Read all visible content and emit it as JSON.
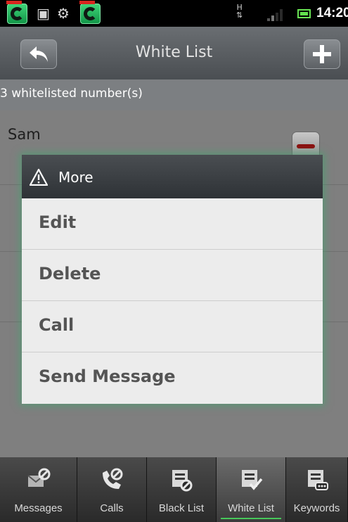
{
  "status_bar": {
    "network_type": "H",
    "time": "14:20",
    "colors": {
      "app_icon": "#1fb35a",
      "battery": "#62e04d"
    }
  },
  "title_bar": {
    "title": "White List",
    "back_icon": "back-arrow-icon",
    "add_icon": "plus-icon"
  },
  "count_text": "3 whitelisted number(s)",
  "list": {
    "contacts": [
      {
        "name": "Sam"
      }
    ]
  },
  "dialog": {
    "title": "More",
    "icon": "warning-icon",
    "items": [
      {
        "label": "Edit"
      },
      {
        "label": "Delete"
      },
      {
        "label": "Call"
      },
      {
        "label": "Send Message"
      }
    ],
    "glow_color": "#3caa6e"
  },
  "tabs": [
    {
      "label": "Messages",
      "icon": "message-block-icon",
      "active": false
    },
    {
      "label": "Calls",
      "icon": "phone-block-icon",
      "active": false
    },
    {
      "label": "Black List",
      "icon": "blacklist-icon",
      "active": false
    },
    {
      "label": "White List",
      "icon": "whitelist-icon",
      "active": true
    },
    {
      "label": "Keywords",
      "icon": "keywords-icon",
      "active": false
    }
  ]
}
